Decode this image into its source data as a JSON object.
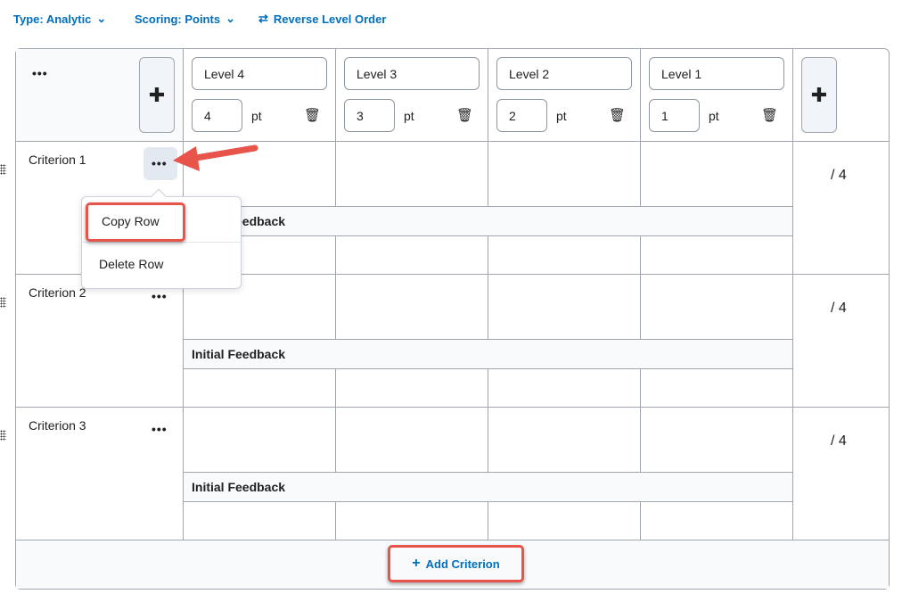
{
  "toolbar": {
    "type": "Type: Analytic",
    "scoring": "Scoring: Points",
    "reverse": "Reverse Level Order"
  },
  "levels": [
    {
      "name": "Level 4",
      "points": "4"
    },
    {
      "name": "Level 3",
      "points": "3"
    },
    {
      "name": "Level 2",
      "points": "2"
    },
    {
      "name": "Level 1",
      "points": "1"
    }
  ],
  "pt_label": "pt",
  "criteria": [
    {
      "name": "Criterion 1",
      "score": "/ 4",
      "feedback": "Initial Feedback"
    },
    {
      "name": "Criterion 2",
      "score": "/ 4",
      "feedback": "Initial Feedback"
    },
    {
      "name": "Criterion 3",
      "score": "/ 4",
      "feedback": "Initial Feedback"
    }
  ],
  "menu": {
    "items": [
      "Copy Row",
      "Delete Row"
    ]
  },
  "add_criterion": "Add Criterion",
  "colors": {
    "accent": "#006fbf",
    "annotation": "#e8534a"
  }
}
